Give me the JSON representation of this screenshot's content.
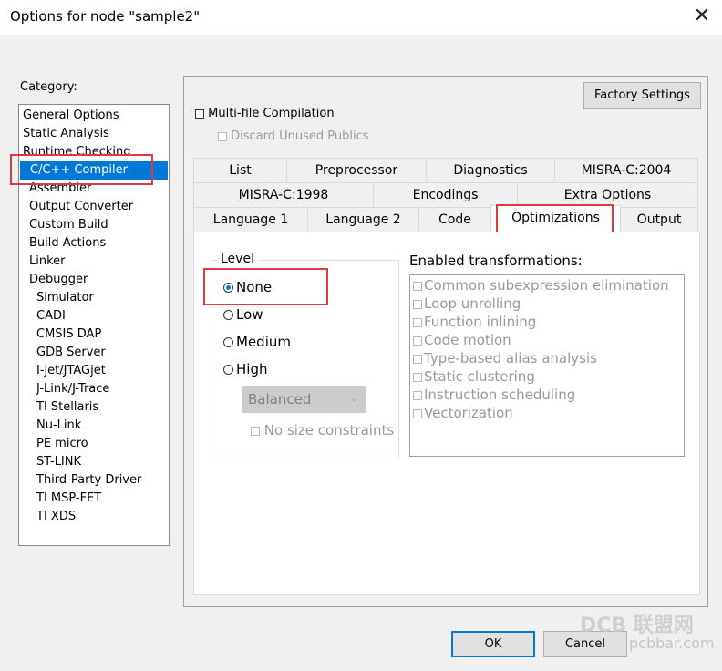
{
  "window": {
    "title": "Options for node \"sample2\"",
    "close_glyph": "✕"
  },
  "category": {
    "label": "Category:",
    "selected": "C/C++ Compiler",
    "items": [
      "General Options",
      "Static Analysis",
      "Runtime Checking",
      "C/C++ Compiler",
      "Assembler",
      "Output Converter",
      "Custom Build",
      "Build Actions",
      "Linker",
      "Debugger",
      "Simulator",
      "CADI",
      "CMSIS DAP",
      "GDB Server",
      "I-jet/JTAGjet",
      "J-Link/J-Trace",
      "TI Stellaris",
      "Nu-Link",
      "PE micro",
      "ST-LINK",
      "Third-Party Driver",
      "TI MSP-FET",
      "TI XDS"
    ]
  },
  "settings": {
    "factory_settings_label": "Factory Settings",
    "multifile_label": "Multi-file Compilation",
    "multifile_checked": false,
    "discard_label": "Discard Unused Publics",
    "discard_enabled": false
  },
  "tabs": {
    "row1": [
      "List",
      "Preprocessor",
      "Diagnostics",
      "MISRA-C:2004"
    ],
    "row2": [
      "MISRA-C:1998",
      "Encodings",
      "Extra Options"
    ],
    "row3": [
      "Language 1",
      "Language 2",
      "Code",
      "Optimizations",
      "Output"
    ],
    "active": "Optimizations"
  },
  "optimizations": {
    "level_label": "Level",
    "levels": [
      "None",
      "Low",
      "Medium",
      "High"
    ],
    "selected_level": "None",
    "high_mode": "Balanced",
    "no_size_label": "No size constraints",
    "transformations_label": "Enabled transformations:",
    "transformations": [
      "Common subexpression elimination",
      "Loop unrolling",
      "Function inlining",
      "Code motion",
      "Type-based alias analysis",
      "Static clustering",
      "Instruction scheduling",
      "Vectorization"
    ]
  },
  "footer": {
    "ok_label": "OK",
    "cancel_label": "Cancel"
  },
  "watermark": {
    "text": "DCB 联盟网",
    "url": "pcbbar.com"
  },
  "colors": {
    "selection": "#0078d7",
    "highlight_box": "#e0393e",
    "disabled_text": "#9a9a9a"
  }
}
